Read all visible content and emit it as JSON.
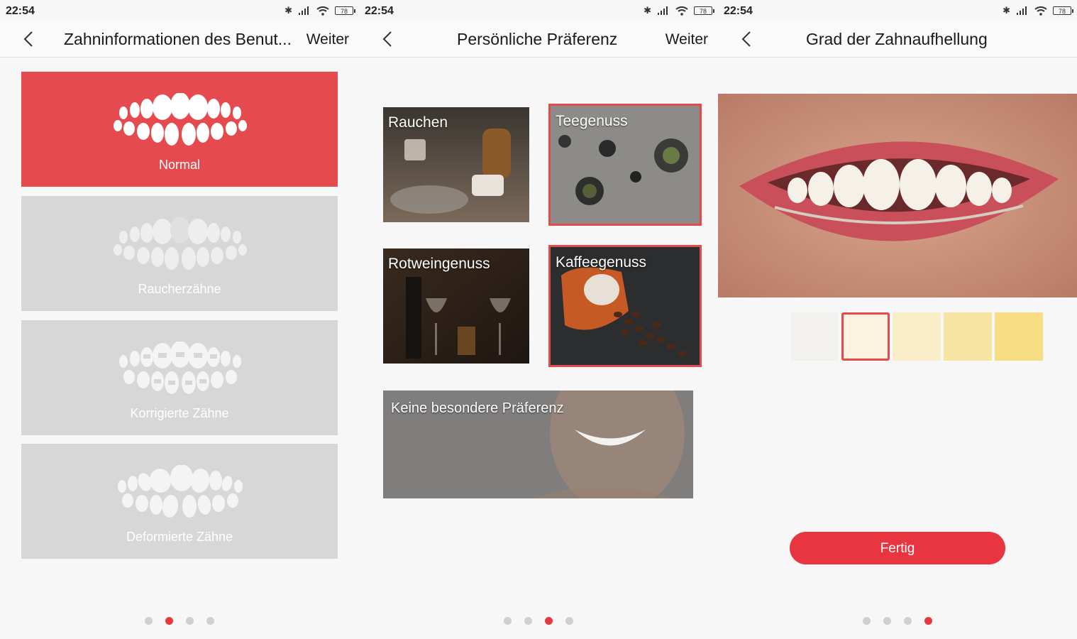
{
  "status": {
    "time": "22:54",
    "battery": "78"
  },
  "screen1": {
    "title": "Zahninformationen des Benut...",
    "next_label": "Weiter",
    "options": [
      {
        "label": "Normal",
        "selected": true
      },
      {
        "label": "Raucherzähne",
        "selected": false
      },
      {
        "label": "Korrigierte Zähne",
        "selected": false
      },
      {
        "label": "Deformierte Zähne",
        "selected": false
      }
    ],
    "page_indicator": {
      "total": 4,
      "active": 2
    }
  },
  "screen2": {
    "title": "Persönliche Präferenz",
    "next_label": "Weiter",
    "preferences": [
      {
        "label": "Rauchen",
        "selected": false
      },
      {
        "label": "Teegenuss",
        "selected": true
      },
      {
        "label": "Rotweingenuss",
        "selected": false
      },
      {
        "label": "Kaffeegenuss",
        "selected": true
      },
      {
        "label": "Keine besondere Präferenz",
        "selected": false
      }
    ],
    "page_indicator": {
      "total": 4,
      "active": 3
    }
  },
  "screen3": {
    "title": "Grad der Zahnaufhellung",
    "shades": [
      {
        "color": "#f3f1ee",
        "selected": false
      },
      {
        "color": "#fbf3df",
        "selected": true
      },
      {
        "color": "#faeec9",
        "selected": false
      },
      {
        "color": "#f8e4a2",
        "selected": false
      },
      {
        "color": "#f6dc82",
        "selected": false
      }
    ],
    "done_label": "Fertig",
    "page_indicator": {
      "total": 4,
      "active": 4
    }
  },
  "colors": {
    "accent": "#e8383d",
    "card_grey": "#d7d7d7"
  }
}
